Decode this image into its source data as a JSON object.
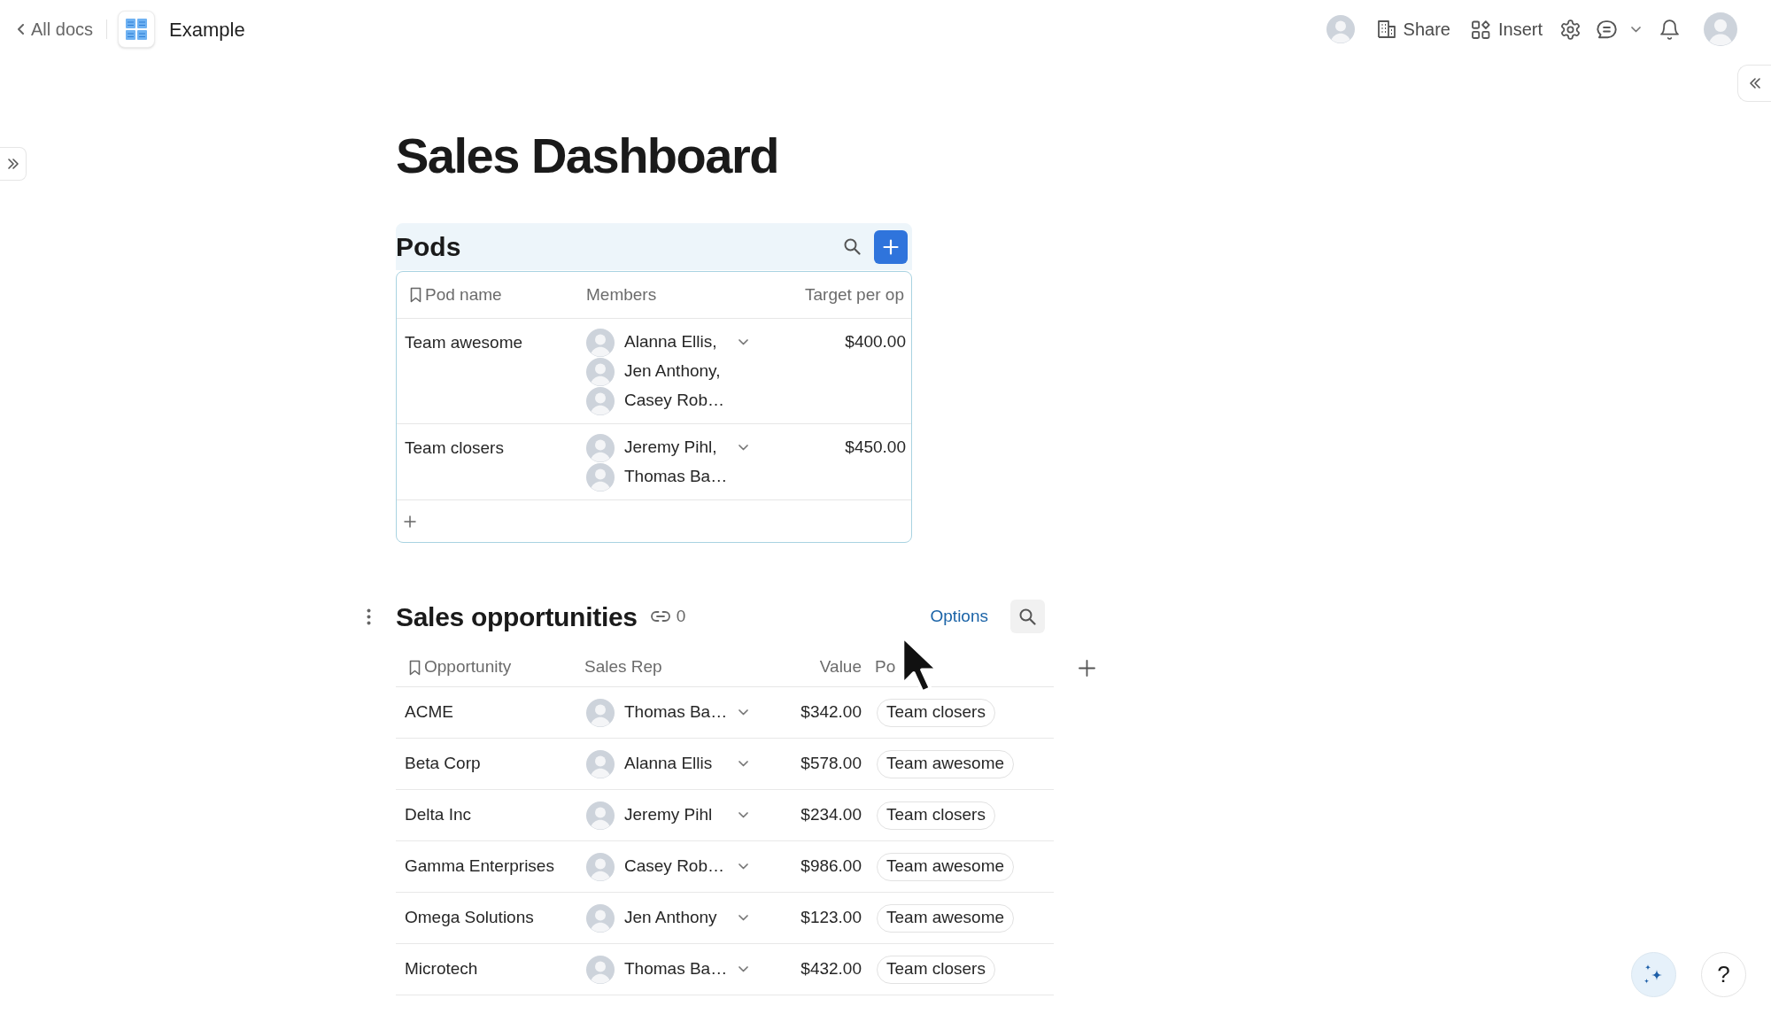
{
  "topbar": {
    "back_link": "All docs",
    "doc_title": "Example",
    "actions": [
      {
        "kind": "share",
        "label": "Share"
      },
      {
        "kind": "insert",
        "label": "Insert"
      }
    ]
  },
  "page_title": "Sales Dashboard",
  "pods": {
    "title": "Pods",
    "columns": [
      "Pod name",
      "Members",
      "Target per op"
    ],
    "rows": [
      {
        "name": "Team awesome",
        "members": [
          "Alanna Ellis,",
          "Jen Anthony,",
          "Casey Rob…"
        ],
        "target": "$400.00"
      },
      {
        "name": "Team closers",
        "members": [
          "Jeremy Pihl,",
          "Thomas Ba…"
        ],
        "target": "$450.00"
      }
    ]
  },
  "opportunities": {
    "title": "Sales opportunities",
    "link_count": "0",
    "options_label": "Options",
    "columns": [
      "Opportunity",
      "Sales Rep",
      "Value",
      "Po"
    ],
    "rows": [
      {
        "opportunity": "ACME",
        "sales_rep": "Thomas Ba…",
        "value": "$342.00",
        "pod": "Team closers"
      },
      {
        "opportunity": "Beta Corp",
        "sales_rep": "Alanna Ellis",
        "value": "$578.00",
        "pod": "Team awesome"
      },
      {
        "opportunity": "Delta Inc",
        "sales_rep": "Jeremy Pihl",
        "value": "$234.00",
        "pod": "Team closers"
      },
      {
        "opportunity": "Gamma Enterprises",
        "sales_rep": "Casey Rob…",
        "value": "$986.00",
        "pod": "Team awesome"
      },
      {
        "opportunity": "Omega Solutions",
        "sales_rep": "Jen Anthony",
        "value": "$123.00",
        "pod": "Team awesome"
      },
      {
        "opportunity": "Microtech",
        "sales_rep": "Thomas Ba…",
        "value": "$432.00",
        "pod": "Team closers"
      }
    ]
  },
  "help_button": "?"
}
